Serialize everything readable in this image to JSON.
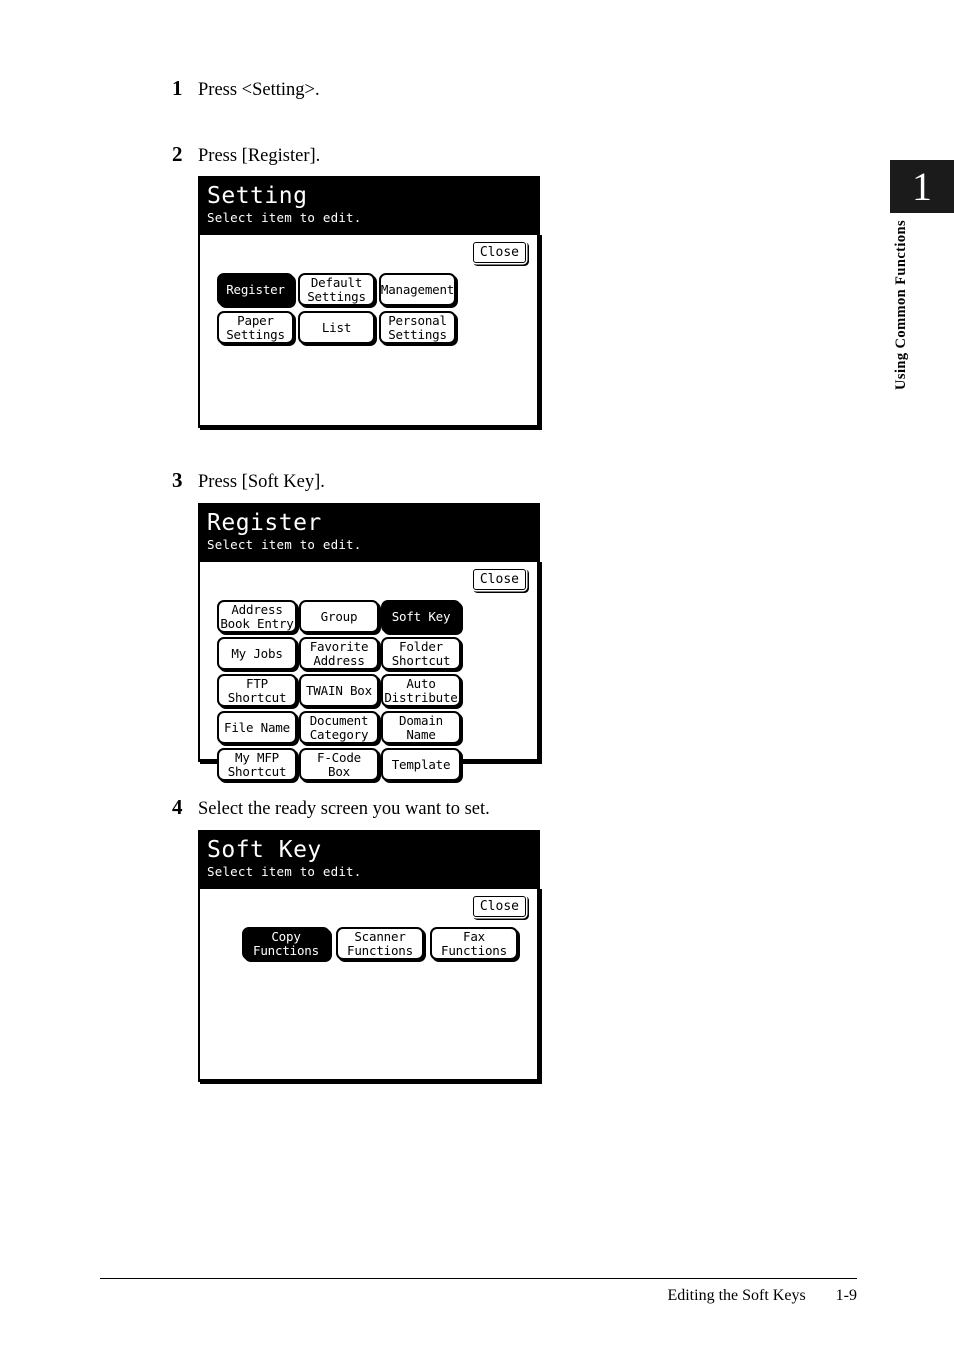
{
  "chapter": {
    "number": "1",
    "label": "Using Common Functions"
  },
  "footer": {
    "title": "Editing the Soft Keys",
    "page": "1-9"
  },
  "steps": [
    {
      "num": "1",
      "text": "Press <Setting>."
    },
    {
      "num": "2",
      "text": "Press [Register]."
    },
    {
      "num": "3",
      "text": "Press [Soft Key]."
    },
    {
      "num": "4",
      "text": "Select the ready screen you want to set."
    }
  ],
  "panels": [
    {
      "title": "Setting",
      "subtitle": "Select item to edit.",
      "close_label": "Close",
      "keys": [
        {
          "line1": "Register",
          "line2": "",
          "selected": true
        },
        {
          "line1": "Default",
          "line2": "Settings",
          "selected": false
        },
        {
          "line1": "Management",
          "line2": "",
          "selected": false
        },
        {
          "line1": "Paper",
          "line2": "Settings",
          "selected": false
        },
        {
          "line1": "List",
          "line2": "",
          "selected": false
        },
        {
          "line1": "Personal",
          "line2": "Settings",
          "selected": false
        }
      ]
    },
    {
      "title": "Register",
      "subtitle": "Select item to edit.",
      "close_label": "Close",
      "keys": [
        {
          "line1": "Address",
          "line2": "Book Entry",
          "selected": false
        },
        {
          "line1": "Group",
          "line2": "",
          "selected": false
        },
        {
          "line1": "Soft Key",
          "line2": "",
          "selected": true
        },
        {
          "line1": "My Jobs",
          "line2": "",
          "selected": false
        },
        {
          "line1": "Favorite",
          "line2": "Address",
          "selected": false
        },
        {
          "line1": "Folder",
          "line2": "Shortcut",
          "selected": false
        },
        {
          "line1": "FTP",
          "line2": "Shortcut",
          "selected": false
        },
        {
          "line1": "TWAIN Box",
          "line2": "",
          "selected": false
        },
        {
          "line1": "Auto",
          "line2": "Distribute",
          "selected": false
        },
        {
          "line1": "File Name",
          "line2": "",
          "selected": false
        },
        {
          "line1": "Document",
          "line2": "Category",
          "selected": false
        },
        {
          "line1": "Domain",
          "line2": "Name",
          "selected": false
        },
        {
          "line1": "My MFP",
          "line2": "Shortcut",
          "selected": false
        },
        {
          "line1": "F-Code",
          "line2": "Box",
          "selected": false
        },
        {
          "line1": "Template",
          "line2": "",
          "selected": false
        }
      ]
    },
    {
      "title": "Soft Key",
      "subtitle": "Select item to edit.",
      "close_label": "Close",
      "keys": [
        {
          "line1": "Copy",
          "line2": "Functions",
          "selected": true
        },
        {
          "line1": "Scanner",
          "line2": "Functions",
          "selected": false
        },
        {
          "line1": "Fax",
          "line2": "Functions",
          "selected": false
        }
      ]
    }
  ]
}
